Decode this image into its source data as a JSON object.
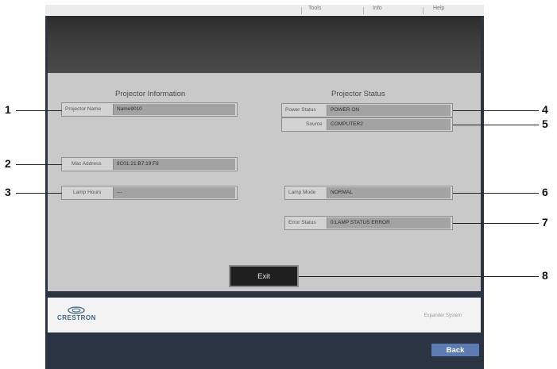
{
  "menu": [
    "Tools",
    "Info",
    "Help"
  ],
  "projector_info": {
    "title": "Projector Information",
    "projector_name_label": "Projector Name",
    "projector_name_value": "Name9010",
    "mac_address_label": "Mac Address",
    "mac_address_value": "8C01:21:B7:19:F8",
    "lamp_hours_label": "Lamp Hours",
    "lamp_hours_value": "---"
  },
  "projector_status": {
    "title": "Projector Status",
    "power_status_label": "Power Status",
    "power_status_value": "POWER ON",
    "source_label": "Source",
    "source_value": "COMPUTER2",
    "lamp_mode_label": "Lamp Mode",
    "lamp_mode_value": "NORMAL",
    "error_status_label": "Error Status",
    "error_status_value": "0:LAMP STATUS ERROR"
  },
  "exit_label": "Exit",
  "footer": {
    "logo": "CRESTRON",
    "expander": "Expander System"
  },
  "back_label": "Back",
  "callouts": [
    "1",
    "2",
    "3",
    "4",
    "5",
    "6",
    "7",
    "8"
  ]
}
